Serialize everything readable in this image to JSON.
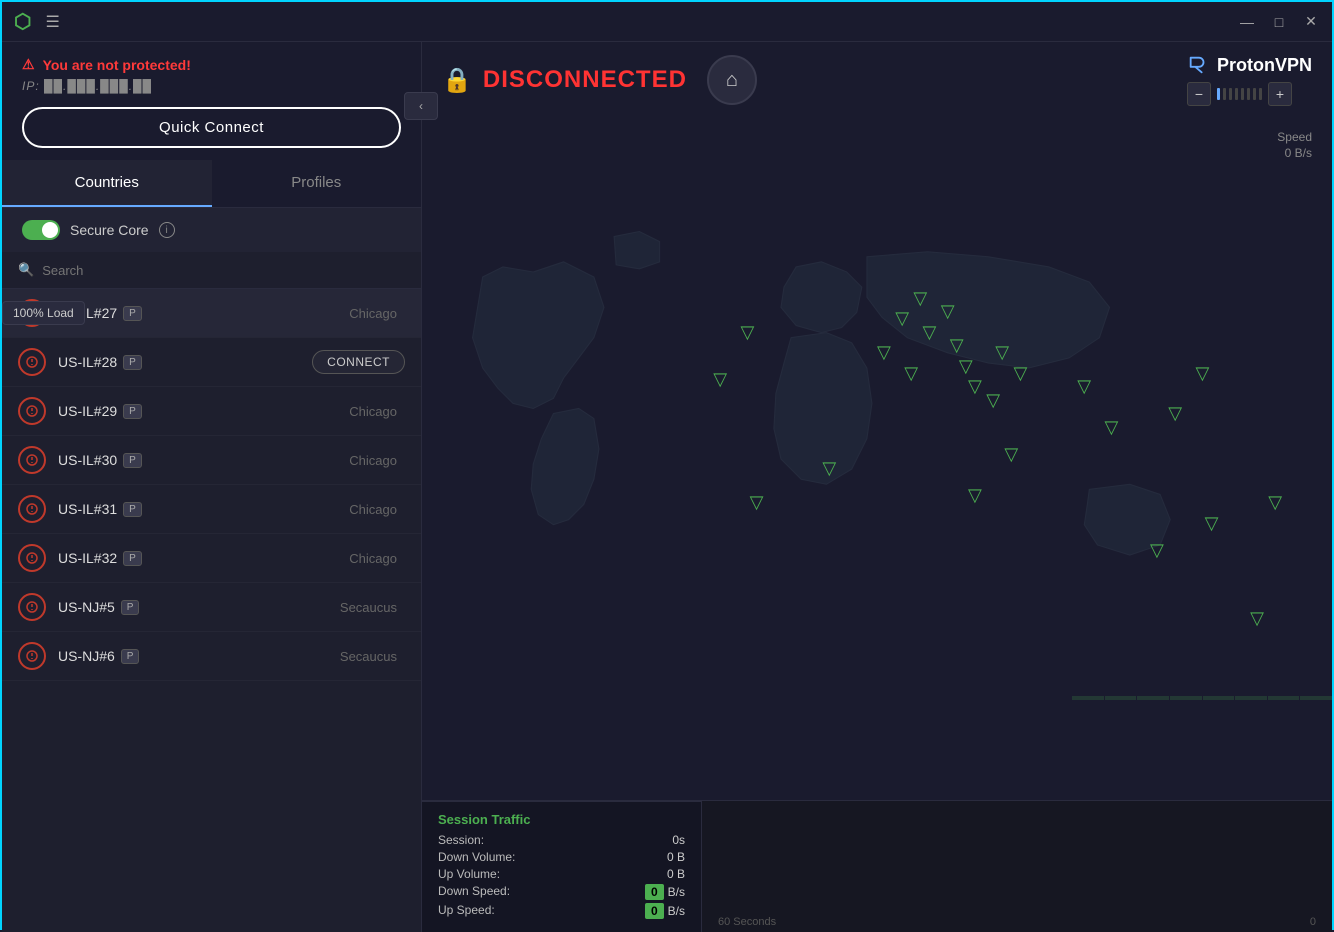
{
  "window": {
    "title": "ProtonVPN",
    "minimize": "—",
    "maximize": "□",
    "close": "✕"
  },
  "titlebar": {
    "logo": "⬡",
    "menu_icon": "☰"
  },
  "status": {
    "warning_icon": "⚠",
    "warning_text": "You are not protected!",
    "ip_label": "IP: ██.███.███.██",
    "quick_connect": "Quick Connect"
  },
  "collapse_btn": "‹",
  "tabs": [
    {
      "id": "countries",
      "label": "Countries",
      "active": true
    },
    {
      "id": "profiles",
      "label": "Profiles",
      "active": false
    }
  ],
  "secure_core": {
    "label": "Secure Core",
    "info": "i"
  },
  "search": {
    "placeholder": "Search",
    "icon": "🔍"
  },
  "servers": [
    {
      "id": "US-IL#27",
      "name": "US-IL#27",
      "location": "Chicago",
      "plus": true,
      "hovered": true,
      "tooltip": "100% Load",
      "connect": null
    },
    {
      "id": "US-IL#28",
      "name": "US-IL#28",
      "location": "",
      "plus": true,
      "hovered": false,
      "tooltip": null,
      "connect": "CONNECT"
    },
    {
      "id": "US-IL#29",
      "name": "US-IL#29",
      "location": "Chicago",
      "plus": true,
      "hovered": false,
      "tooltip": null,
      "connect": null
    },
    {
      "id": "US-IL#30",
      "name": "US-IL#30",
      "location": "Chicago",
      "plus": true,
      "hovered": false,
      "tooltip": null,
      "connect": null
    },
    {
      "id": "US-IL#31",
      "name": "US-IL#31",
      "location": "Chicago",
      "plus": true,
      "hovered": false,
      "tooltip": null,
      "connect": null
    },
    {
      "id": "US-IL#32",
      "name": "US-IL#32",
      "location": "Chicago",
      "plus": true,
      "hovered": false,
      "tooltip": null,
      "connect": null
    },
    {
      "id": "US-NJ#5",
      "name": "US-NJ#5",
      "location": "Secaucus",
      "plus": true,
      "hovered": false,
      "tooltip": null,
      "connect": null
    },
    {
      "id": "US-NJ#6",
      "name": "US-NJ#6",
      "location": "Secaucus",
      "plus": true,
      "hovered": false,
      "tooltip": null,
      "connect": null
    }
  ],
  "map": {
    "status": "DISCONNECTED",
    "lock_icon": "🔒",
    "home_icon": "⌂",
    "brand": "ProtonVPN",
    "zoom_minus": "−",
    "zoom_plus": "+",
    "speed_label": "Speed",
    "speed_value": "0 B/s",
    "time_label": "60 Seconds",
    "time_value": "0"
  },
  "stats": {
    "title": "Session Traffic",
    "session_label": "Session:",
    "session_value": "0s",
    "down_vol_label": "Down Volume:",
    "down_vol_value": "0",
    "down_vol_unit": "B",
    "up_vol_label": "Up Volume:",
    "up_vol_value": "0",
    "up_vol_unit": "B",
    "down_speed_label": "Down Speed:",
    "down_speed_value": "0",
    "down_speed_unit": "B/s",
    "up_speed_label": "Up Speed:",
    "up_speed_value": "0",
    "up_speed_unit": "B/s"
  },
  "markers": [
    {
      "x": 47,
      "y": 38
    },
    {
      "x": 51,
      "y": 33
    },
    {
      "x": 52,
      "y": 36
    },
    {
      "x": 54,
      "y": 34
    },
    {
      "x": 55,
      "y": 37
    },
    {
      "x": 57,
      "y": 35
    },
    {
      "x": 58,
      "y": 38
    },
    {
      "x": 59,
      "y": 40
    },
    {
      "x": 60,
      "y": 42
    },
    {
      "x": 62,
      "y": 44
    },
    {
      "x": 63,
      "y": 40
    },
    {
      "x": 65,
      "y": 43
    },
    {
      "x": 67,
      "y": 46
    },
    {
      "x": 68,
      "y": 41
    },
    {
      "x": 70,
      "y": 44
    },
    {
      "x": 72,
      "y": 48
    },
    {
      "x": 74,
      "y": 52
    },
    {
      "x": 76,
      "y": 56
    },
    {
      "x": 78,
      "y": 60
    },
    {
      "x": 80,
      "y": 64
    },
    {
      "x": 85,
      "y": 70
    },
    {
      "x": 88,
      "y": 50
    },
    {
      "x": 90,
      "y": 55
    },
    {
      "x": 35,
      "y": 42
    },
    {
      "x": 37,
      "y": 50
    },
    {
      "x": 42,
      "y": 55
    },
    {
      "x": 48,
      "y": 62
    },
    {
      "x": 60,
      "y": 68
    },
    {
      "x": 95,
      "y": 75
    }
  ]
}
